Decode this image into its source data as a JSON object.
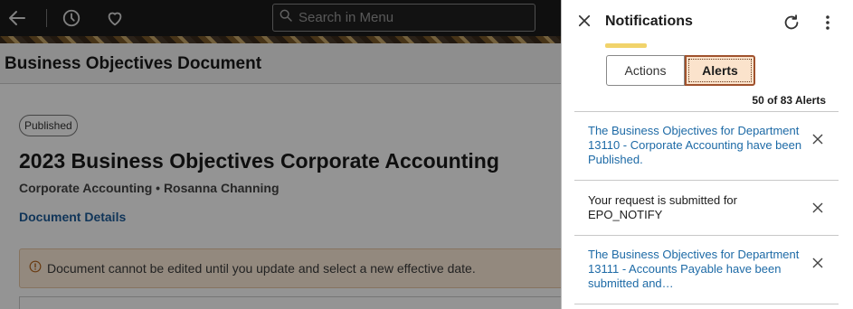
{
  "topbar": {
    "search_placeholder": "Search in Menu",
    "icons": [
      "back-arrow-icon",
      "history-clock-icon",
      "favorites-heart-icon",
      "search-icon"
    ]
  },
  "page": {
    "title": "Business Objectives Document",
    "status_badge": "Published",
    "document_title": "2023 Business Objectives Corporate Accounting",
    "meta": "Corporate Accounting • Rosanna Channing",
    "details_link": "Document Details",
    "warning": "Document cannot be edited until you update and select a new effective date."
  },
  "notifications": {
    "title": "Notifications",
    "tabs": {
      "actions": "Actions",
      "alerts": "Alerts",
      "selected": "Alerts"
    },
    "count": "50 of 83 Alerts",
    "items": [
      {
        "text": "The Business Objectives for Department 13110 - Corporate Accounting have been Published.",
        "style": "link"
      },
      {
        "text": "Your request is submitted for EPO_NOTIFY",
        "style": "plain"
      },
      {
        "text": "The Business Objectives for Department 13111 - Accounts Payable have been submitted and…",
        "style": "link"
      }
    ]
  },
  "colors": {
    "link": "#1d6aa6",
    "warning_bg": "#fdecd9",
    "selected_tab_bg": "#fbe3cc",
    "accent": "#f1d36b"
  }
}
